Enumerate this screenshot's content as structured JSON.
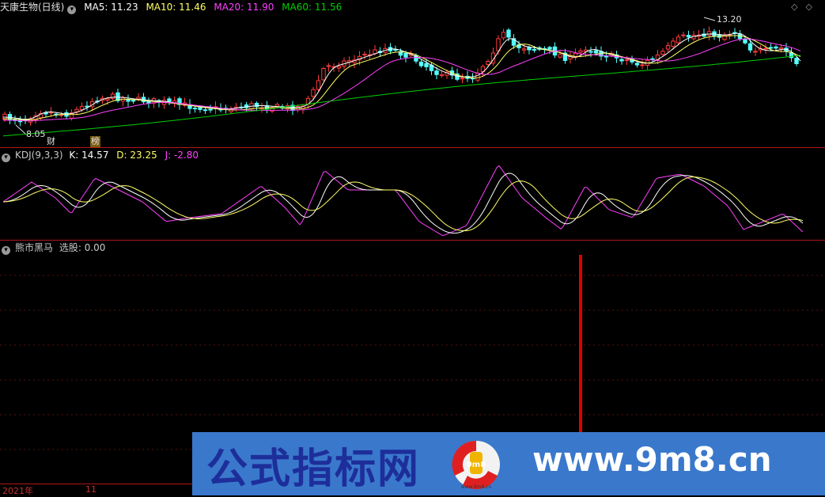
{
  "header": {
    "stock_title": "天康生物(日线)",
    "ma5": "MA5: 11.23",
    "ma10": "MA10: 11.46",
    "ma20": "MA20: 11.90",
    "ma60": "MA60: 11.56",
    "icons": [
      "prev-icon",
      "next-icon"
    ]
  },
  "main_chart": {
    "high_label": "13.20",
    "low_label": "8.05",
    "badge_cai": "财",
    "badge_bang": "榜"
  },
  "kdj": {
    "title": "KDJ(9,3,3)",
    "k": "K: 14.57",
    "d": "D: 23.25",
    "j": "J: -2.80"
  },
  "indicator": {
    "title": "熊市黑马",
    "value": "选股: 0.00"
  },
  "axis": {
    "year": "2021年",
    "month": "11"
  },
  "watermark": {
    "left_text": "公式指标网",
    "right_text": "www.9m8.cn",
    "logo_text": "9m8",
    "logo_caption": "www.9m8.cn"
  },
  "colors": {
    "bull": "#ff3b3b",
    "bear": "#54ffff",
    "ma5": "#ffffff",
    "ma10": "#ffff66",
    "ma20": "#ff40ff",
    "ma60": "#00d000",
    "kline": "#ffffff",
    "dline": "#ffff66",
    "jline": "#ff40ff",
    "signal": "#e00000",
    "separator": "#b01818"
  }
}
